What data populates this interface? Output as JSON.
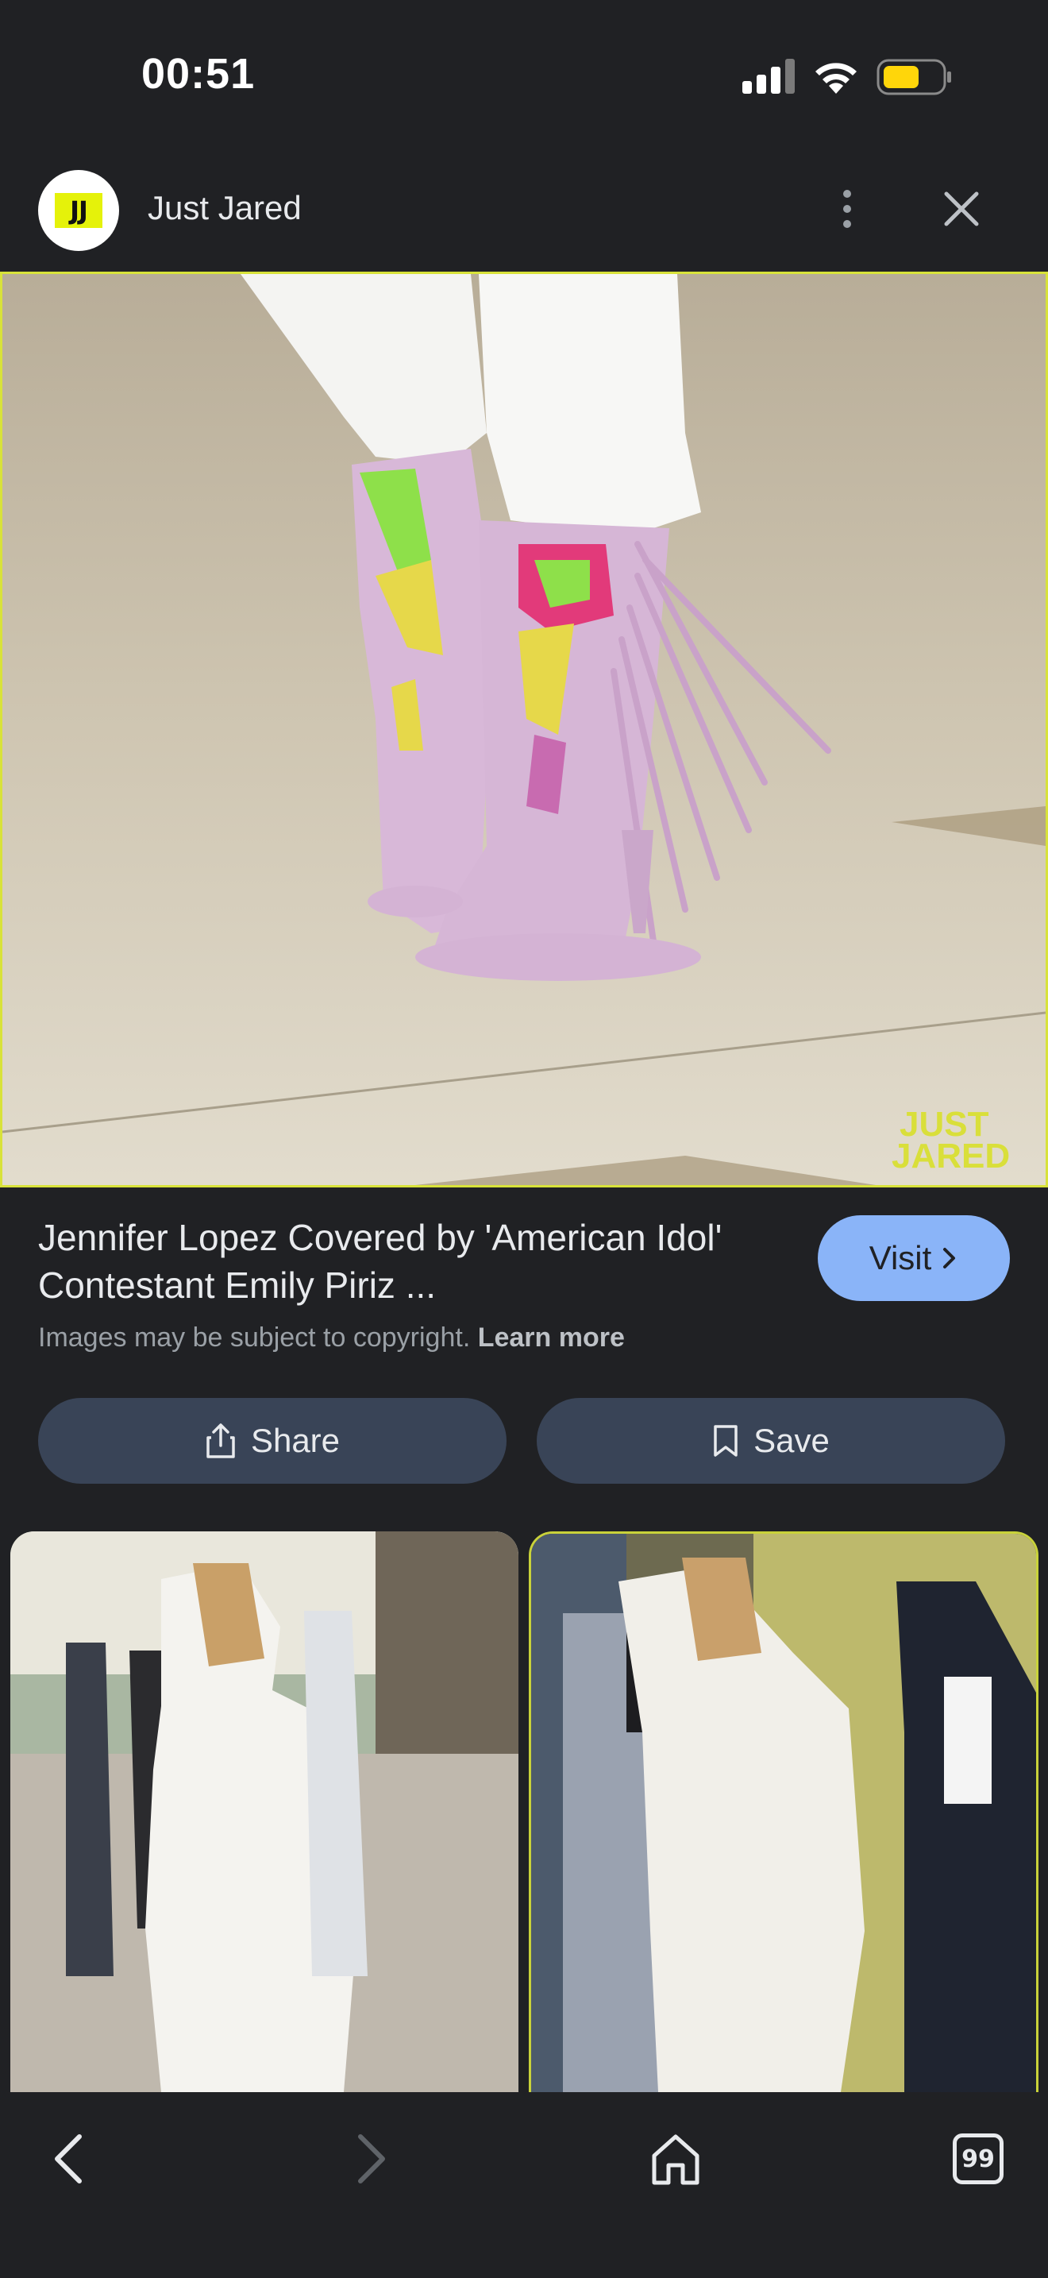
{
  "status_bar": {
    "time": "00:51"
  },
  "header": {
    "site_name": "Just Jared",
    "logo_text": "JJ"
  },
  "main_image": {
    "watermark_line1": "JUST",
    "watermark_line2": "JARED"
  },
  "result": {
    "title": "Jennifer Lopez Covered by 'American Idol' Contestant Emily Piriz ...",
    "visit_label": "Visit",
    "copyright_text": "Images may be subject to copyright.",
    "learn_more": "Learn more"
  },
  "actions": {
    "share_label": "Share",
    "save_label": "Save"
  },
  "bottom_nav": {
    "tabs_count": "99"
  },
  "colors": {
    "background": "#202124",
    "visit_button": "#8ab4f8",
    "action_button": "#394457",
    "accent_border": "#d8e23a"
  }
}
